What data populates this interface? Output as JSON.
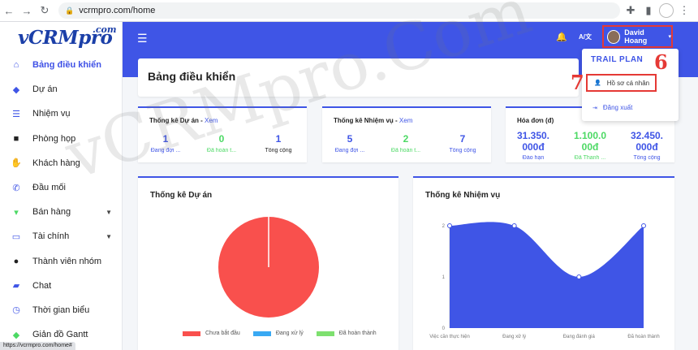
{
  "browser": {
    "url": "vcrmpro.com/home"
  },
  "logo": {
    "brand": "vCRMpro",
    "com": ".com"
  },
  "sidebar": {
    "items": [
      {
        "label": "Bảng điều khiển",
        "icon": "home-icon",
        "glyph": "⌂"
      },
      {
        "label": "Dự án",
        "icon": "layers-icon",
        "glyph": "◆"
      },
      {
        "label": "Nhiệm vụ",
        "icon": "list-icon",
        "glyph": "☰"
      },
      {
        "label": "Phòng họp",
        "icon": "video-icon",
        "glyph": "■"
      },
      {
        "label": "Khách hàng",
        "icon": "handshake-icon",
        "glyph": "✋"
      },
      {
        "label": "Đầu mối",
        "icon": "phone-icon",
        "glyph": "✆"
      },
      {
        "label": "Bán hàng",
        "icon": "cart-icon",
        "glyph": "▾"
      },
      {
        "label": "Tài chính",
        "icon": "card-icon",
        "glyph": "▭"
      },
      {
        "label": "Thành viên nhóm",
        "icon": "users-icon",
        "glyph": "●"
      },
      {
        "label": "Chat",
        "icon": "chat-icon",
        "glyph": "▰"
      },
      {
        "label": "Thời gian biểu",
        "icon": "clock-icon",
        "glyph": "◷"
      },
      {
        "label": "Giản đồ Gantt",
        "icon": "layers-icon",
        "glyph": "◆"
      }
    ]
  },
  "topbar": {
    "lang": "A/文",
    "user_name": "David Hoang"
  },
  "dropdown": {
    "title": "TRAIL PLAN",
    "profile": "Hồ sơ cá nhân",
    "logout": "Đăng xuất"
  },
  "annotations": {
    "six": "6",
    "seven": "7"
  },
  "page": {
    "title": "Bảng điều khiển"
  },
  "stats": {
    "projects": {
      "title": "Thống kê Dự án - ",
      "link": "Xem",
      "cols": [
        {
          "value": "1",
          "label": "Đang đợi ..."
        },
        {
          "value": "0",
          "label": "Đã hoàn t..."
        },
        {
          "value": "1",
          "label": "Tổng cộng"
        }
      ]
    },
    "tasks": {
      "title": "Thống kê Nhiệm vụ - ",
      "link": "Xem",
      "cols": [
        {
          "value": "5",
          "label": "Đang đợi ..."
        },
        {
          "value": "2",
          "label": "Đã hoàn t..."
        },
        {
          "value": "7",
          "label": "Tổng cộng"
        }
      ]
    },
    "invoices": {
      "title": "Hóa đơn (đ)",
      "cols": [
        {
          "value_line1": "31.350.",
          "value_line2": "000đ",
          "label": "Đáo hạn"
        },
        {
          "value_line1": "1.100.0",
          "value_line2": "00đ",
          "label": "Đã Thanh ..."
        },
        {
          "value_line1": "32.450.",
          "value_line2": "000đ",
          "label": "Tổng cộng"
        }
      ]
    }
  },
  "colors": {
    "primary": "#3f55e6",
    "red": "#f9504d",
    "green": "#4cd964",
    "light_blue": "#39a9f3",
    "annotation": "#e53935"
  },
  "watermark": "vCRMpro.Com",
  "status_url": "https://vcrmpro.com/home#",
  "chart_data": [
    {
      "type": "pie",
      "title": "Thống kê Dự án",
      "categories": [
        "Chưa bắt đầu",
        "Đang xử lý",
        "Đã hoàn thành"
      ],
      "values": [
        1,
        0,
        0
      ],
      "colors": [
        "#f9504d",
        "#39a9f3",
        "#7ee06f"
      ],
      "legend": "bottom"
    },
    {
      "type": "area",
      "title": "Thống kê Nhiệm vụ",
      "categories": [
        "Việc cần thực hiện",
        "Đang xử lý",
        "Đang đánh giá",
        "Đã hoàn thành"
      ],
      "values": [
        2,
        2,
        1,
        2
      ],
      "ylim": [
        0,
        2
      ],
      "yticks": [
        "0",
        "1",
        "2"
      ],
      "color": "#3f55e6"
    }
  ]
}
